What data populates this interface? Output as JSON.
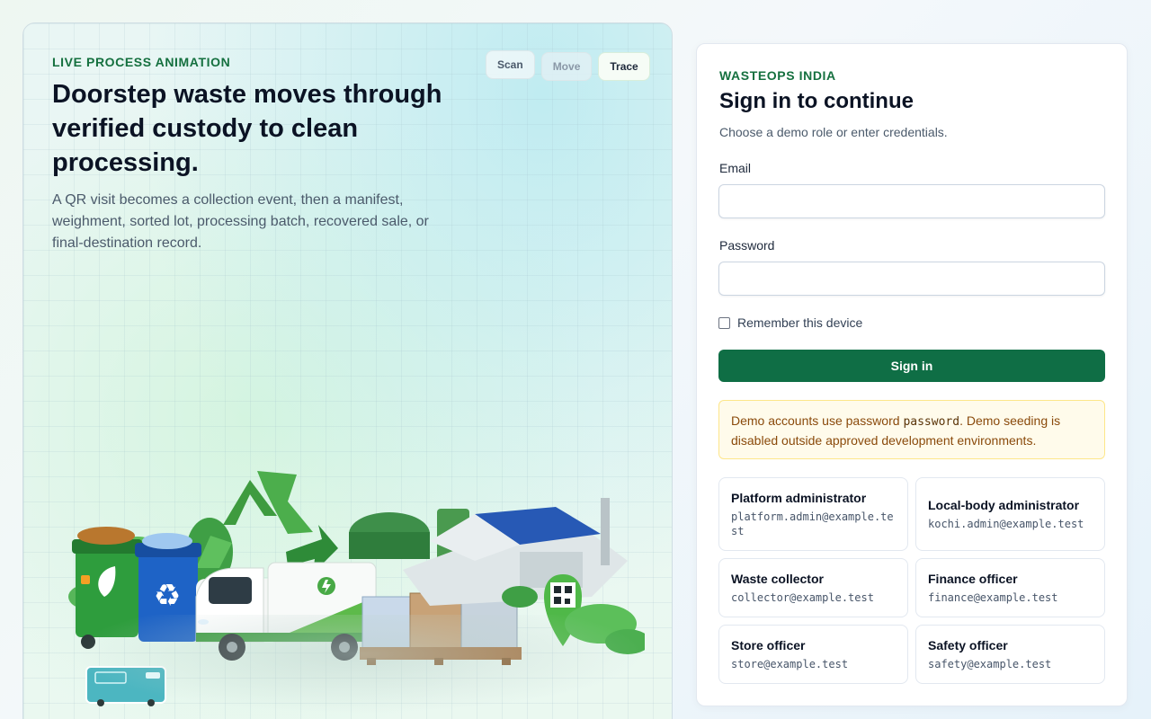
{
  "hero": {
    "eyebrow": "LIVE PROCESS ANIMATION",
    "title": "Doorstep waste moves through verified custody to clean processing.",
    "description": "A QR visit becomes a collection event, then a manifest, weighment, sorted lot, processing batch, recovered sale, or final-destination record.",
    "steps": [
      {
        "label": "Scan",
        "state": "normal"
      },
      {
        "label": "Move",
        "state": "dim"
      },
      {
        "label": "Trace",
        "state": "active"
      }
    ]
  },
  "login": {
    "brand": "WASTEOPS INDIA",
    "title": "Sign in to continue",
    "subtitle": "Choose a demo role or enter credentials.",
    "email_label": "Email",
    "email_value": "",
    "password_label": "Password",
    "password_value": "",
    "remember_label": "Remember this device",
    "remember_checked": false,
    "submit_label": "Sign in",
    "notice": {
      "prefix": "Demo accounts use password ",
      "code": "password",
      "suffix": ". Demo seeding is disabled outside approved development environments."
    },
    "roles": [
      {
        "name": "Platform administrator",
        "email": "platform.admin@example.test"
      },
      {
        "name": "Local-body administrator",
        "email": "kochi.admin@example.test"
      },
      {
        "name": "Waste collector",
        "email": "collector@example.test"
      },
      {
        "name": "Finance officer",
        "email": "finance@example.test"
      },
      {
        "name": "Store officer",
        "email": "store@example.test"
      },
      {
        "name": "Safety officer",
        "email": "safety@example.test"
      }
    ]
  },
  "colors": {
    "brand_green": "#0f6e45",
    "eyebrow_green": "#15703f",
    "notice_bg": "#fffbeb",
    "notice_text": "#8a4a0b"
  }
}
